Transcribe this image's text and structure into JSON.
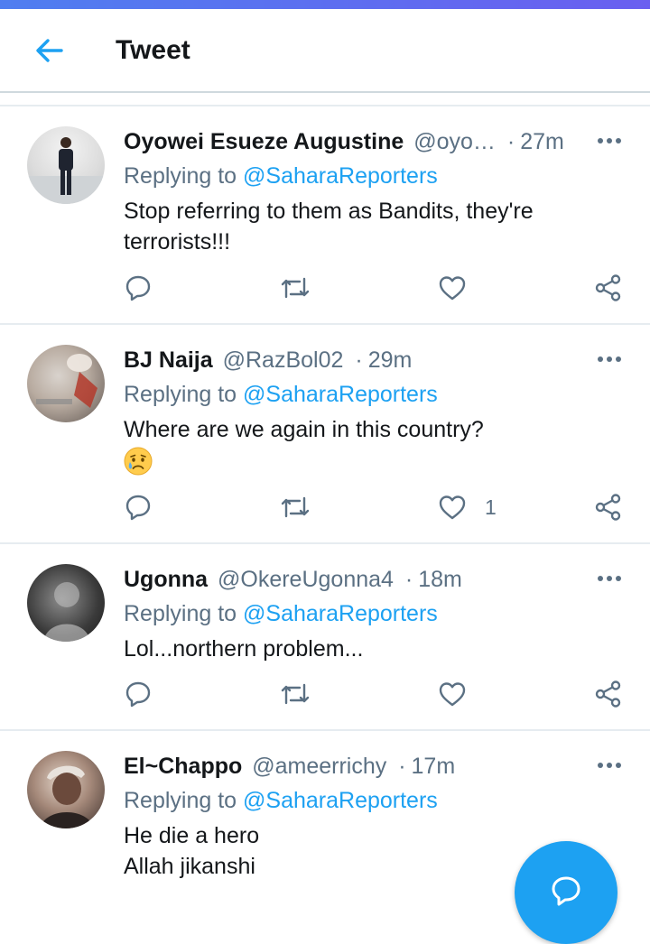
{
  "header": {
    "title": "Tweet",
    "back_icon": "arrow-left-icon"
  },
  "colors": {
    "accent": "#1da1f2",
    "text_primary": "#14171a",
    "text_secondary": "#5b7083",
    "divider": "#e6ecf0"
  },
  "tweets": [
    {
      "display_name": "Oyowei Esueze Augustine",
      "handle": "@oyo…",
      "time": "27m",
      "replying_prefix": "Replying to",
      "replying_to": "@SaharaReporters",
      "text_lines": [
        "Stop referring to them as Bandits, they're",
        "terrorists!!!"
      ],
      "like_count": ""
    },
    {
      "display_name": "BJ Naija",
      "handle": "@RazBol02",
      "time": "29m",
      "replying_prefix": "Replying to",
      "replying_to": "@SaharaReporters",
      "text_lines": [
        "Where are we again in this country?"
      ],
      "emoji": "sad-but-relieved-face-emoji",
      "like_count": "1"
    },
    {
      "display_name": "Ugonna",
      "handle": "@OkereUgonna4",
      "time": "18m",
      "replying_prefix": "Replying to",
      "replying_to": "@SaharaReporters",
      "text_lines": [
        "Lol...northern problem..."
      ],
      "like_count": ""
    },
    {
      "display_name": "El~Chappo",
      "handle": "@ameerrichy",
      "time": "17m",
      "replying_prefix": "Replying to",
      "replying_to": "@SaharaReporters",
      "text_lines": [
        "He die a hero",
        "Allah jikanshi"
      ],
      "like_count": ""
    }
  ],
  "fab": {
    "icon": "compose-reply-icon"
  }
}
